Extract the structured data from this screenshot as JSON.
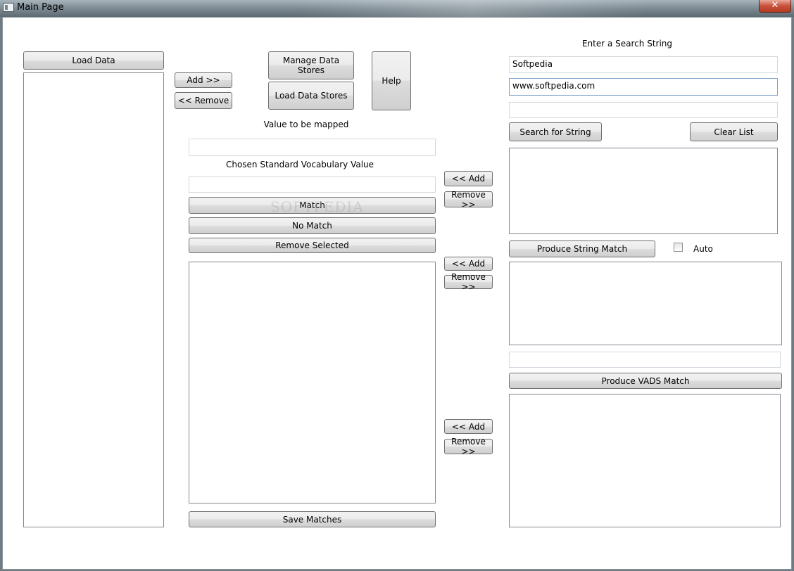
{
  "window": {
    "title": "Main Page",
    "close_glyph": "✕",
    "watermark": "SOFTPEDIA"
  },
  "left": {
    "load_data_label": "Load Data"
  },
  "mid": {
    "add_label": "Add >>",
    "remove_label": "<< Remove",
    "manage_stores_label": "Manage Data Stores",
    "load_stores_label": "Load Data Stores",
    "help_label": "Help",
    "value_to_map_label": "Value to be mapped",
    "value_to_map": "",
    "vocab_label": "Chosen Standard Vocabulary Value",
    "vocab_value": "",
    "match_label": "Match",
    "no_match_label": "No Match",
    "remove_selected_label": "Remove Selected",
    "save_matches_label": "Save Matches",
    "watermark": "SOFTPEDIA"
  },
  "center_arrows": {
    "group1": {
      "add": "<< Add",
      "remove": "Remove >>"
    },
    "group2": {
      "add": "<< Add",
      "remove": "Remove >>"
    },
    "group3": {
      "add": "<< Add",
      "remove": "Remove >>"
    }
  },
  "right": {
    "search_header": "Enter a Search String",
    "search_field_1": "Softpedia",
    "search_field_2": "www.softpedia.com",
    "search_field_3": "",
    "search_button": "Search for String",
    "clear_button": "Clear List",
    "produce_string_button": "Produce String Match",
    "auto_label": "Auto",
    "auto_checked": false,
    "vads_field": "",
    "produce_vads_button": "Produce VADS Match"
  }
}
